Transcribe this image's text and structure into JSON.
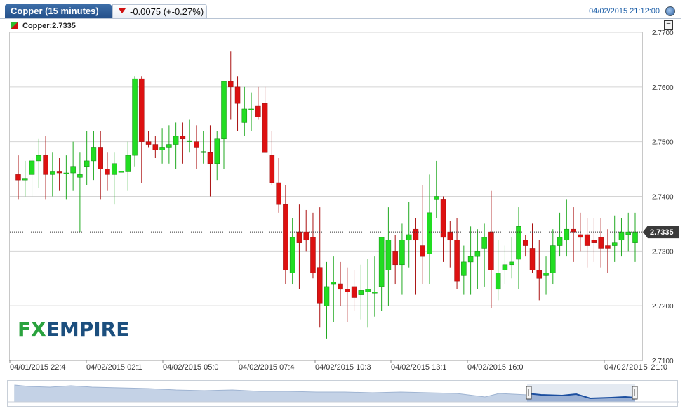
{
  "header": {
    "instrument_tab": "Copper (15 minutes)",
    "change_text": "-0.0075 (+-0.27%)",
    "timestamp": "04/02/2015 21:12:00"
  },
  "legend": {
    "label": "Copper:2.7335"
  },
  "logo": {
    "fx": "FX",
    "empire": "EMPIRE"
  },
  "colors": {
    "up": "#22dd22",
    "down": "#dd1111",
    "accent": "#1d5fa8"
  },
  "chart_data": {
    "type": "candlestick",
    "title": "Copper (15 minutes)",
    "last_price": 2.7335,
    "last_price_label": "2.7335",
    "ylim": [
      2.71,
      2.77
    ],
    "y_ticks": [
      "2.7100",
      "2.7200",
      "2.7300",
      "2.7400",
      "2.7500",
      "2.7600",
      "2.7700"
    ],
    "x_ticks": [
      "04/01/2015 22:4",
      "04/02/2015 02:1",
      "04/02/2015 05:0",
      "04/02/2015 07:4",
      "04/02/2015 10:3",
      "04/02/2015 13:1",
      "04/02/2015 16:0",
      "04/02/2015 21:0"
    ],
    "grid": true,
    "candles": [
      [
        2.744,
        2.7475,
        2.7395,
        2.743
      ],
      [
        2.743,
        2.7465,
        2.74,
        2.7432
      ],
      [
        2.744,
        2.747,
        2.74,
        2.7465
      ],
      [
        2.7465,
        2.7505,
        2.7415,
        2.7475
      ],
      [
        2.7475,
        2.751,
        2.7395,
        2.744
      ],
      [
        2.744,
        2.748,
        2.74,
        2.7445
      ],
      [
        2.7445,
        2.747,
        2.741,
        2.7443
      ],
      [
        2.7442,
        2.7475,
        2.7395,
        2.7443
      ],
      [
        2.7443,
        2.75,
        2.741,
        2.7455
      ],
      [
        2.7435,
        2.748,
        2.7335,
        2.744
      ],
      [
        2.7455,
        2.752,
        2.742,
        2.7465
      ],
      [
        2.7465,
        2.752,
        2.743,
        2.749
      ],
      [
        2.749,
        2.752,
        2.7395,
        2.745
      ],
      [
        2.745,
        2.748,
        2.741,
        2.744
      ],
      [
        2.744,
        2.748,
        2.7385,
        2.746
      ],
      [
        2.7445,
        2.7475,
        2.742,
        2.7446
      ],
      [
        2.7445,
        2.75,
        2.741,
        2.7475
      ],
      [
        2.7475,
        2.762,
        2.7455,
        2.7615
      ],
      [
        2.7615,
        2.762,
        2.7425,
        2.75
      ],
      [
        2.75,
        2.752,
        2.749,
        2.7495
      ],
      [
        2.7495,
        2.751,
        2.747,
        2.7485
      ],
      [
        2.7485,
        2.7525,
        2.746,
        2.749
      ],
      [
        2.749,
        2.753,
        2.746,
        2.7495
      ],
      [
        2.7495,
        2.7535,
        2.745,
        2.751
      ],
      [
        2.751,
        2.7535,
        2.746,
        2.7505
      ],
      [
        2.7502,
        2.754,
        2.748,
        2.7502
      ],
      [
        2.75,
        2.753,
        2.745,
        2.749
      ],
      [
        2.748,
        2.752,
        2.746,
        2.7482
      ],
      [
        2.748,
        2.753,
        2.74,
        2.746
      ],
      [
        2.746,
        2.752,
        2.743,
        2.7505
      ],
      [
        2.7505,
        2.761,
        2.745,
        2.761
      ],
      [
        2.761,
        2.7665,
        2.754,
        2.76
      ],
      [
        2.76,
        2.762,
        2.752,
        2.757
      ],
      [
        2.7535,
        2.76,
        2.751,
        2.756
      ],
      [
        2.756,
        2.759,
        2.752,
        2.756
      ],
      [
        2.7565,
        2.76,
        2.754,
        2.7545
      ],
      [
        2.757,
        2.76,
        2.748,
        2.748
      ],
      [
        2.7475,
        2.752,
        2.742,
        2.7425
      ],
      [
        2.7425,
        2.747,
        2.737,
        2.7385
      ],
      [
        2.7385,
        2.742,
        2.724,
        2.7265
      ],
      [
        2.726,
        2.736,
        2.724,
        2.7325
      ],
      [
        2.7335,
        2.7385,
        2.723,
        2.7315
      ],
      [
        2.7335,
        2.7375,
        2.73,
        2.732
      ],
      [
        2.7325,
        2.737,
        2.725,
        2.726
      ],
      [
        2.727,
        2.738,
        2.716,
        2.7205
      ],
      [
        2.72,
        2.728,
        2.714,
        2.7235
      ],
      [
        2.724,
        2.729,
        2.717,
        2.7243
      ],
      [
        2.724,
        2.728,
        2.72,
        2.723
      ],
      [
        2.723,
        2.727,
        2.717,
        2.7225
      ],
      [
        2.7235,
        2.7265,
        2.719,
        2.7215
      ],
      [
        2.722,
        2.7275,
        2.7175,
        2.7228
      ],
      [
        2.7225,
        2.7285,
        2.716,
        2.723
      ],
      [
        2.7225,
        2.729,
        2.718,
        2.7225
      ],
      [
        2.7235,
        2.727,
        2.719,
        2.7325
      ],
      [
        2.7265,
        2.738,
        2.72,
        2.732
      ],
      [
        2.73,
        2.733,
        2.724,
        2.7275
      ],
      [
        2.7275,
        2.735,
        2.722,
        2.732
      ],
      [
        2.732,
        2.739,
        2.727,
        2.733
      ],
      [
        2.734,
        2.736,
        2.722,
        2.732
      ],
      [
        2.731,
        2.742,
        2.724,
        2.729
      ],
      [
        2.7295,
        2.744,
        2.724,
        2.737
      ],
      [
        2.7395,
        2.7465,
        2.736,
        2.74
      ],
      [
        2.7395,
        2.74,
        2.728,
        2.7325
      ],
      [
        2.7335,
        2.7355,
        2.727,
        2.732
      ],
      [
        2.732,
        2.736,
        2.723,
        2.7245
      ],
      [
        2.7255,
        2.731,
        2.722,
        2.728
      ],
      [
        2.728,
        2.7345,
        2.722,
        2.729
      ],
      [
        2.729,
        2.734,
        2.723,
        2.73
      ],
      [
        2.7305,
        2.735,
        2.7235,
        2.7325
      ],
      [
        2.7335,
        2.741,
        2.7195,
        2.7265
      ],
      [
        2.723,
        2.732,
        2.721,
        2.726
      ],
      [
        2.7265,
        2.731,
        2.724,
        2.7275
      ],
      [
        2.7275,
        2.7325,
        2.725,
        2.728
      ],
      [
        2.7285,
        2.738,
        2.723,
        2.7345
      ],
      [
        2.732,
        2.733,
        2.729,
        2.731
      ],
      [
        2.7305,
        2.735,
        2.726,
        2.7265
      ],
      [
        2.7265,
        2.732,
        2.721,
        2.725
      ],
      [
        2.7255,
        2.729,
        2.722,
        2.726
      ],
      [
        2.726,
        2.734,
        2.724,
        2.731
      ],
      [
        2.731,
        2.737,
        2.729,
        2.7325
      ],
      [
        2.732,
        2.7395,
        2.729,
        2.734
      ],
      [
        2.734,
        2.738,
        2.728,
        2.7335
      ],
      [
        2.733,
        2.737,
        2.73,
        2.7325
      ],
      [
        2.733,
        2.736,
        2.727,
        2.731
      ],
      [
        2.732,
        2.736,
        2.728,
        2.7315
      ],
      [
        2.7325,
        2.736,
        2.727,
        2.7305
      ],
      [
        2.731,
        2.734,
        2.726,
        2.7305
      ],
      [
        2.731,
        2.7365,
        2.728,
        2.7315
      ],
      [
        2.732,
        2.736,
        2.729,
        2.7335
      ],
      [
        2.733,
        2.737,
        2.73,
        2.7335
      ],
      [
        2.7315,
        2.737,
        2.728,
        2.7335
      ]
    ],
    "candle_format": [
      "open",
      "high",
      "low",
      "close"
    ]
  }
}
